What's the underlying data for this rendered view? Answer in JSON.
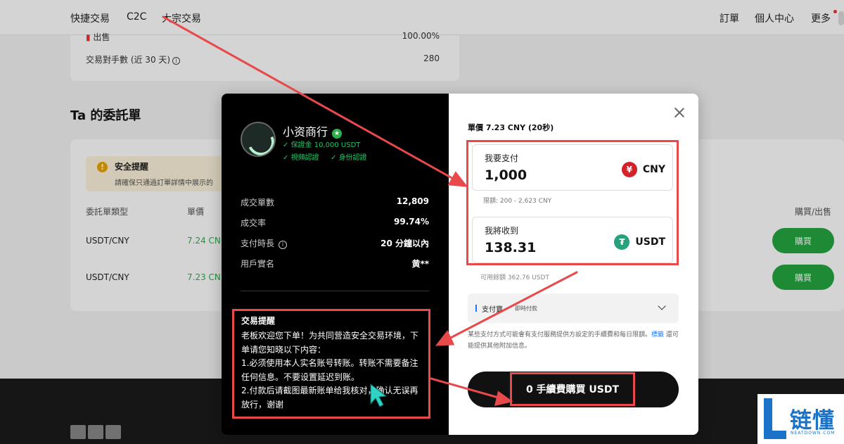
{
  "nav": {
    "left": [
      "快捷交易",
      "C2C",
      "大宗交易"
    ],
    "right": [
      "訂單",
      "個人中心",
      "更多"
    ]
  },
  "stats_card": {
    "row1_label": "出售",
    "row1_value": "100.00%",
    "row2_label": "交易對手數 (近 30 天)",
    "row2_value": "280"
  },
  "section_title": "Ta 的委託單",
  "warning": {
    "title": "安全提醒",
    "text": "請確保只通過訂單詳情中展示的"
  },
  "orders_table": {
    "headers": [
      "委託單類型",
      "單價",
      "購買/出售"
    ],
    "rows": [
      {
        "pair": "USDT/CNY",
        "price": "7.24 CN",
        "action": "購買"
      },
      {
        "pair": "USDT/CNY",
        "price": "7.23 CN",
        "action": "購買"
      }
    ]
  },
  "merchant": {
    "name": "小资商行",
    "deposit": "保證金 10,000 USDT",
    "video": "視頻認證",
    "id": "身份認證"
  },
  "merchant_stats": [
    {
      "label": "成交單數",
      "value": "12,809"
    },
    {
      "label": "成交率",
      "value": "99.74%"
    },
    {
      "label": "支付時長",
      "value": "20 分鐘以內"
    },
    {
      "label": "用戶實名",
      "value": "黄**"
    }
  ],
  "notice": {
    "title": "交易提醒",
    "text": "老板欢迎您下单！为共同营造安全交易环境，下单请您知晓以下内容：\n1.必须使用本人实名账号转账。转账不需要备注任何信息。不要设置延迟到账。\n2.付款后请截图最新账单给我核对，确认无误再放行，谢谢"
  },
  "trade": {
    "unit_price": "單價 7.23 CNY (20秒)",
    "pay_label": "我要支付",
    "pay_value": "1,000",
    "pay_currency": "CNY",
    "limit": "限額: 200 - 2,623 CNY",
    "receive_label": "我將收到",
    "receive_value": "138.31",
    "receive_currency": "USDT",
    "balance": "可用餘額 362.76 USDT",
    "method_name": "支付寶",
    "method_sub": "即時付款",
    "fee_note_a": "某些支付方式可能會有支付服務提供方設定的手續費和每日限額。",
    "fee_note_link": "標籤",
    "fee_note_b": " 還可能提供其他附加信息。",
    "buy_button": "0 手續費購買 USDT"
  },
  "icons": {
    "cny": "¥",
    "usdt": "₮"
  },
  "colors": {
    "accent_green": "#2bb24c",
    "highlight_red": "#e8494b",
    "link_blue": "#1677ff"
  },
  "watermark": {
    "text": "链懂",
    "sub": "NEATDOWN.COM"
  }
}
